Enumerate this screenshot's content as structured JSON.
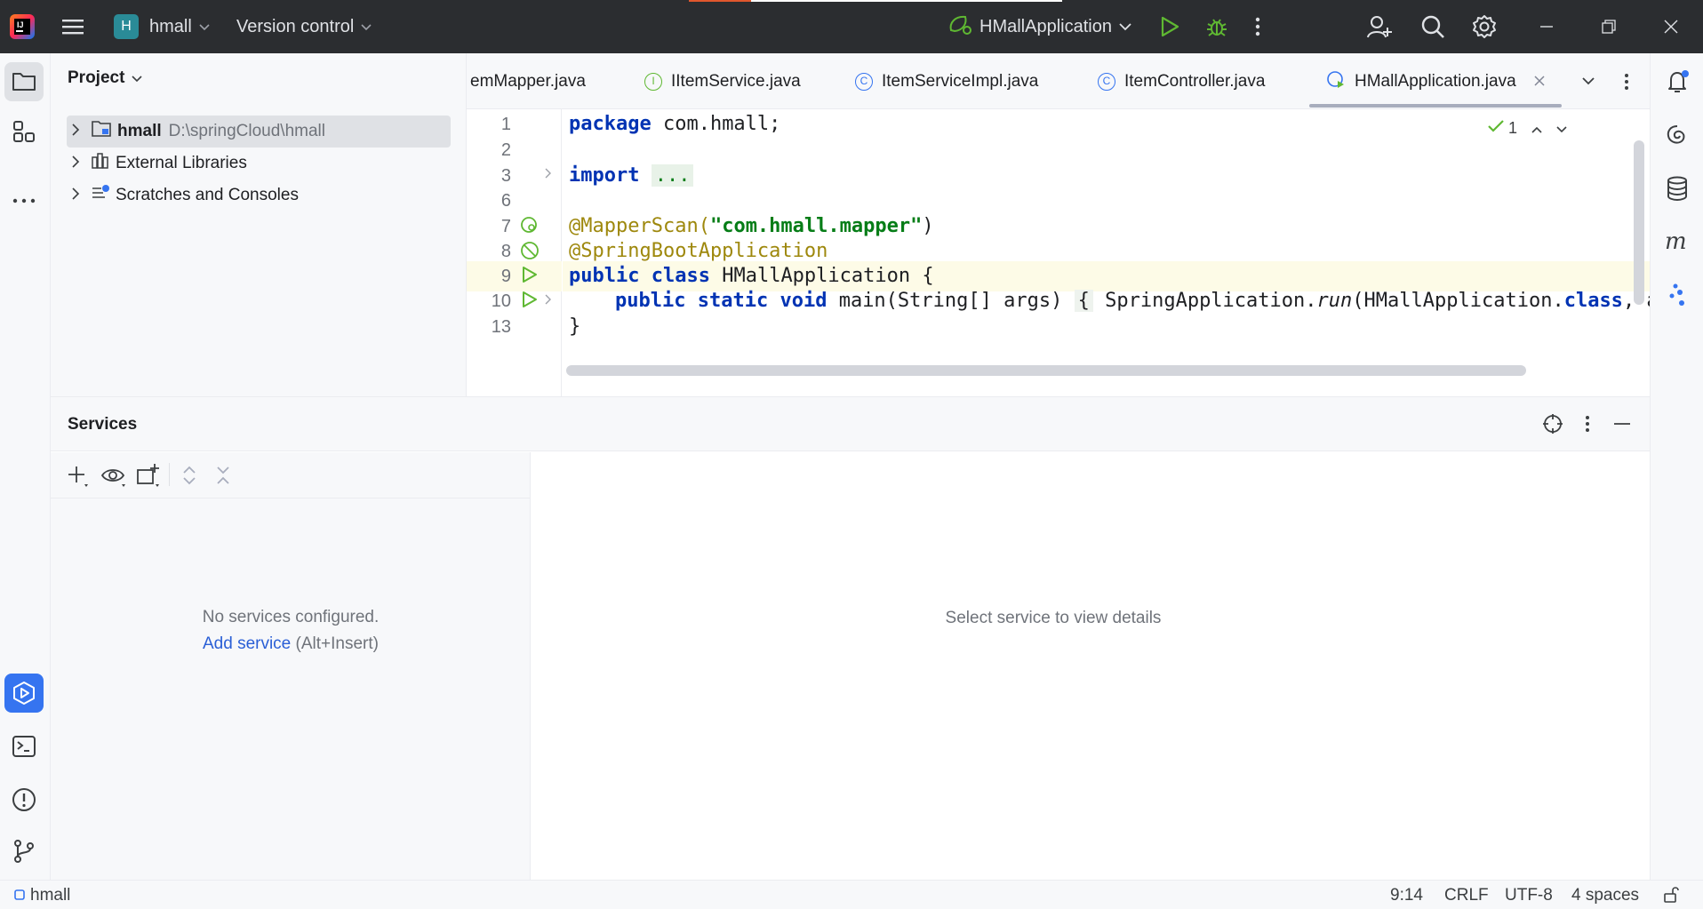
{
  "titlebar": {
    "project_badge": "H",
    "project_name": "hmall",
    "vcs_label": "Version control",
    "run_config": "HMallApplication"
  },
  "project_panel": {
    "title": "Project",
    "tree": [
      {
        "label": "hmall",
        "path": "D:\\springCloud\\hmall"
      },
      {
        "label": "External Libraries"
      },
      {
        "label": "Scratches and Consoles"
      }
    ]
  },
  "editor": {
    "tabs": [
      {
        "label": "emMapper.java"
      },
      {
        "label": "IItemService.java",
        "icon": "I"
      },
      {
        "label": "ItemServiceImpl.java",
        "icon": "C"
      },
      {
        "label": "ItemController.java",
        "icon": "C"
      },
      {
        "label": "HMallApplication.java",
        "active": true
      }
    ],
    "inspection_count": "1",
    "line_numbers": [
      "1",
      "2",
      "3",
      "6",
      "7",
      "8",
      "9",
      "10",
      "13"
    ],
    "code": {
      "l1_kw": "package",
      "l1_rest": " com.hmall;",
      "l3_kw": "import",
      "l3_fold": "...",
      "l7_ann": "@MapperScan(",
      "l7_str": "\"com.hmall.mapper\"",
      "l7_end": ")",
      "l8_ann": "@SpringBootApplication",
      "l9_kw1": "public",
      "l9_kw2": "class",
      "l9_rest": " HMallApplication {",
      "l10_kw1": "public",
      "l10_kw2": "static",
      "l10_kw3": "void",
      "l10_a": " main(String[] args) ",
      "l10_brace": "{",
      "l10_b": " SpringApplication.",
      "l10_run": "run",
      "l10_c": "(HMallApplication.",
      "l10_kw4": "class",
      "l10_d": ", arg",
      "l13": "}"
    }
  },
  "services": {
    "title": "Services",
    "empty_text": "No services configured.",
    "add_link": "Add service",
    "add_shortcut": "(Alt+Insert)",
    "detail_placeholder": "Select service to view details"
  },
  "statusbar": {
    "project": "hmall",
    "position": "9:14",
    "line_sep": "CRLF",
    "encoding": "UTF-8",
    "indent": "4 spaces"
  }
}
